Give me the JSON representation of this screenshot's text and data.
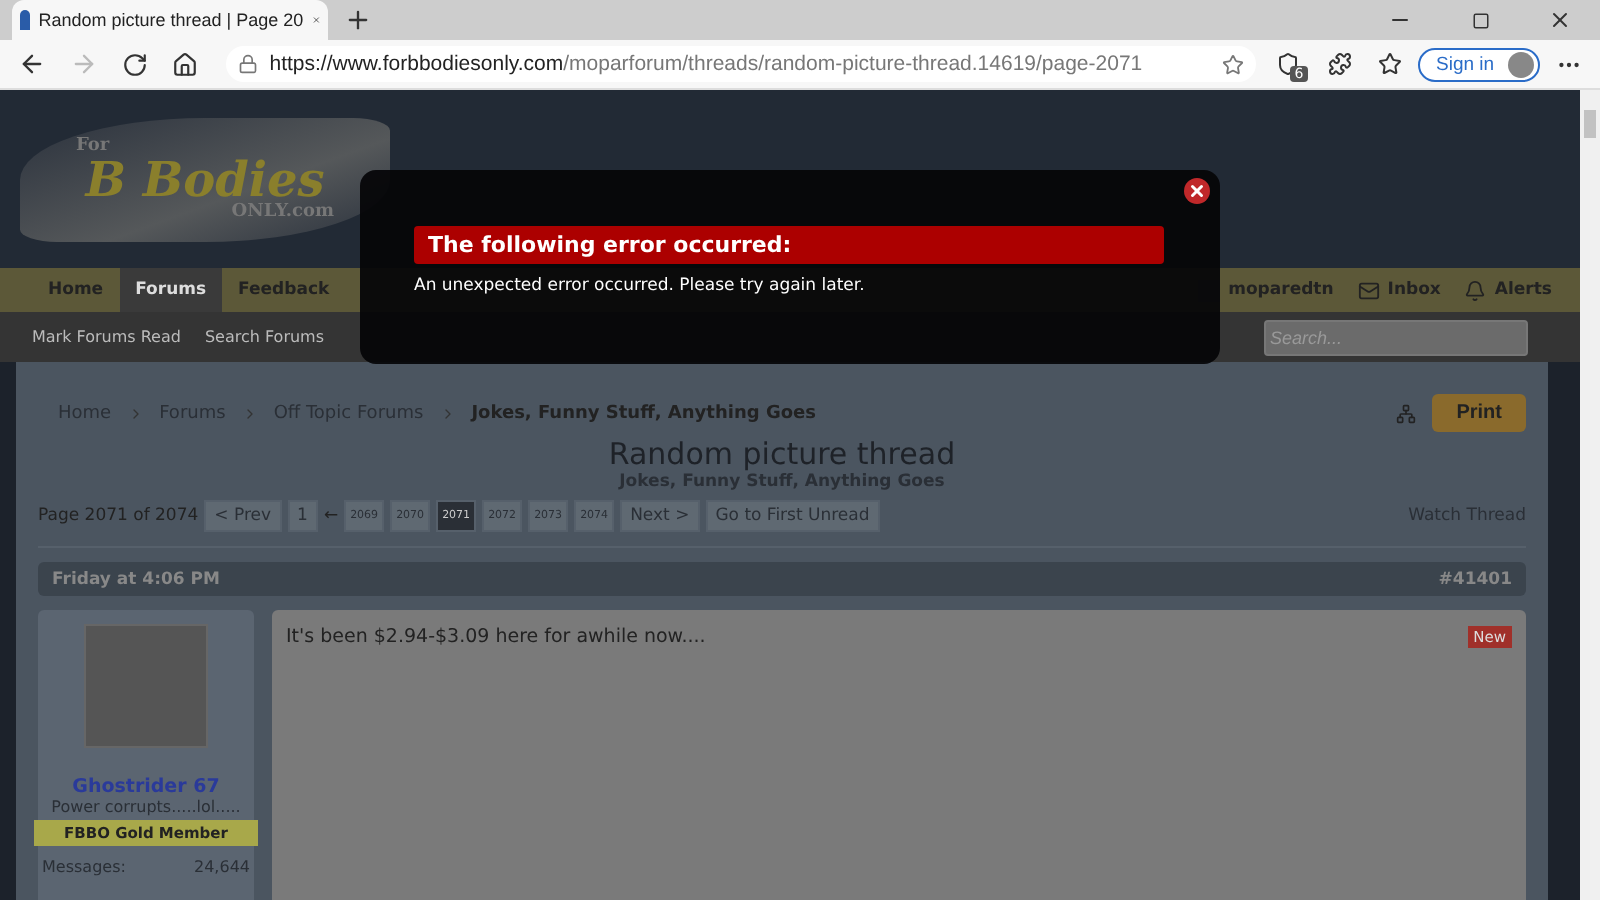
{
  "browser": {
    "tab": {
      "title": "Random picture thread | Page 20",
      "selected": true
    },
    "url": {
      "host": "https://www.forbbodiesonly.com",
      "path": "/moparforum/threads/random-picture-thread.14619/page-2071"
    },
    "forward_disabled": true,
    "extension_badge": "6",
    "sign_in": "Sign in"
  },
  "site": {
    "nav_tabs": [
      {
        "label": "Home",
        "selected": false
      },
      {
        "label": "Forums",
        "selected": true
      },
      {
        "label": "Feedback",
        "selected": false
      }
    ],
    "logo": {
      "top": "For",
      "main": "B Bodies",
      "bottom": "ONLY.com"
    },
    "user_links": [
      {
        "kind": "user",
        "label": "moparedtn"
      },
      {
        "kind": "inbox",
        "label": "Inbox"
      },
      {
        "kind": "alerts",
        "label": "Alerts"
      }
    ],
    "sub_nav": [
      "Mark Forums Read",
      "Search Forums"
    ],
    "search": {
      "placeholder": "Search..."
    }
  },
  "breadcrumbs": [
    "Home",
    "Forums",
    "Off Topic Forums",
    "Jokes, Funny Stuff, Anything Goes"
  ],
  "print_button": "Print",
  "thread": {
    "title": "Random picture thread",
    "subtitle": "Jokes, Funny Stuff, Anything Goes"
  },
  "pagination": {
    "label": "Page 2071 of 2074",
    "prev": "< Prev",
    "first": "1",
    "ellipsis": "←",
    "pages": [
      {
        "label": "2069",
        "selected": false
      },
      {
        "label": "2070",
        "selected": false
      },
      {
        "label": "2071",
        "selected": true
      },
      {
        "label": "2072",
        "selected": false
      },
      {
        "label": "2073",
        "selected": false
      },
      {
        "label": "2074",
        "selected": false
      }
    ],
    "next": "Next >",
    "unread": "Go to First Unread",
    "watch": "Watch Thread"
  },
  "post": {
    "date": "Friday at 4:06 PM",
    "number": "#41401",
    "user": {
      "name": "Ghostrider 67",
      "tagline": "Power corrupts.....lol.....",
      "rank": "FBBO Gold Member",
      "stats": [
        {
          "label": "Messages:",
          "value": "24,644"
        }
      ]
    },
    "body": "It's been $2.94-$3.09 here for awhile now....",
    "new_badge": "New"
  },
  "error_dialog": {
    "title": "The following error occurred:",
    "message": "An unexpected error occurred. Please try again later."
  }
}
